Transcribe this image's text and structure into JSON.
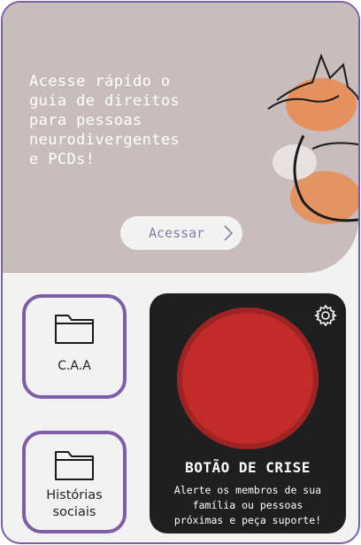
{
  "hero": {
    "text": "Acesse rápido o\nguia de direitos\npara pessoas\nneurodivergentes\ne PCDs!",
    "button_label": "Acessar",
    "illustration_icon": "fox-illustration"
  },
  "tiles": [
    {
      "label": "C.A.A",
      "icon": "folder-icon"
    },
    {
      "label": "Histórias\nsociais",
      "icon": "folder-icon"
    }
  ],
  "crisis": {
    "title": "BOTÃO DE CRISE",
    "description": "Alerte os membros de sua\nfamília ou pessoas\npróximas e peça suporte!",
    "settings_icon": "gear-icon",
    "button_color": "#c32b2b"
  },
  "colors": {
    "accent": "#7e5fa6",
    "hero_bg": "#c8bcbc",
    "panel_bg": "#1f1f1f",
    "page_bg": "#f2f2f2"
  }
}
